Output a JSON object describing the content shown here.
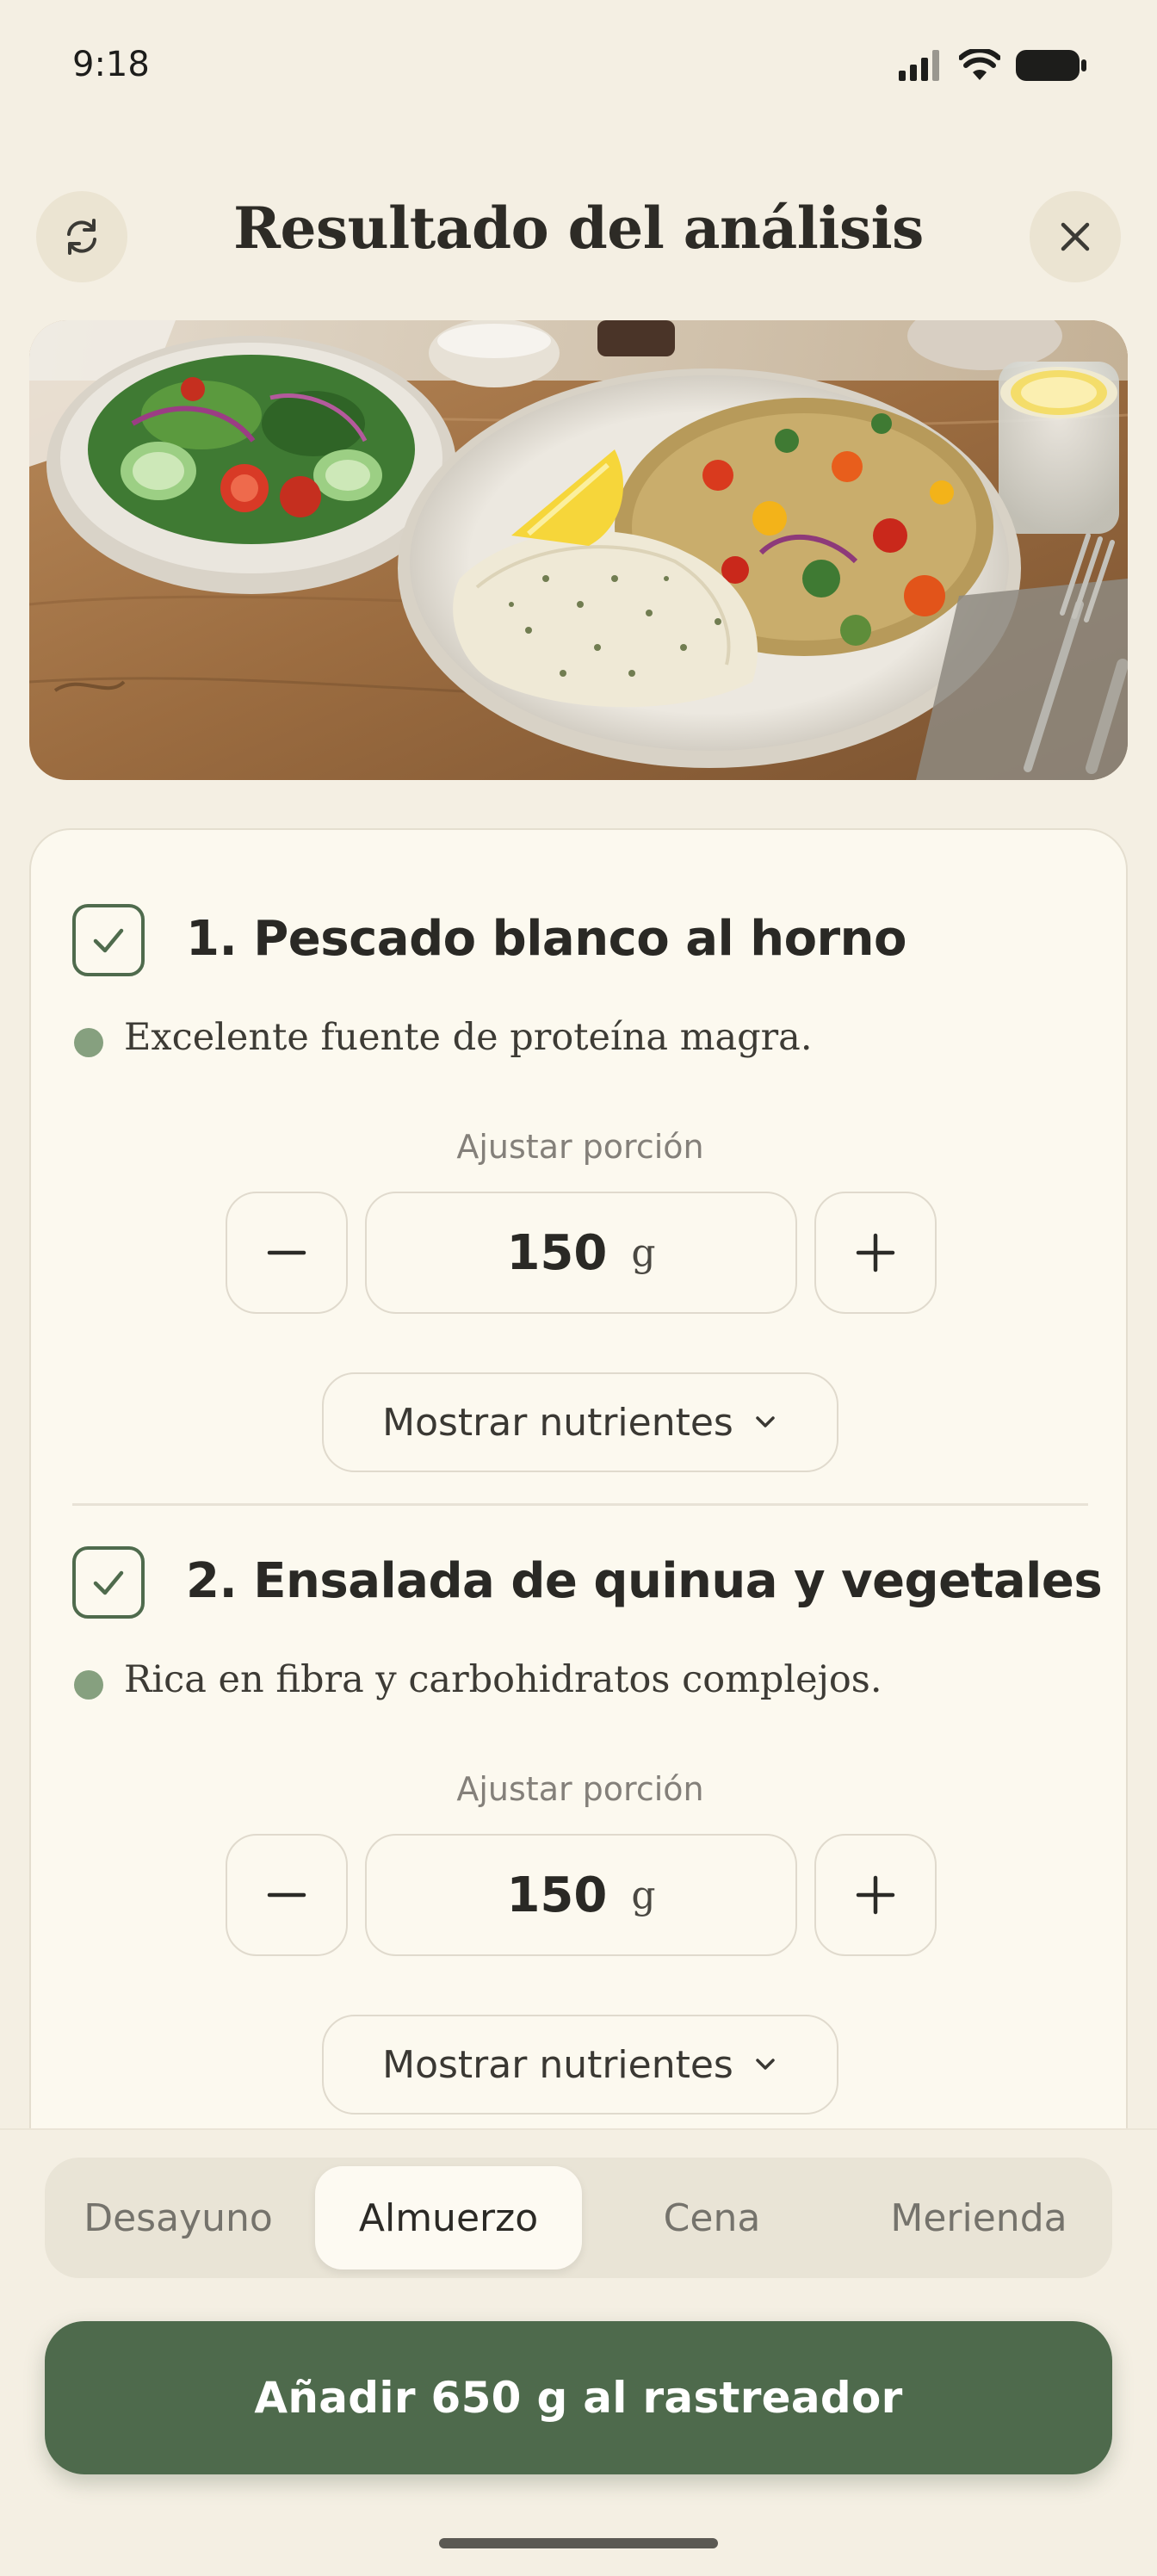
{
  "status_bar": {
    "time": "9:18"
  },
  "header": {
    "title": "Resultado del análisis",
    "refresh_icon": "refresh-icon",
    "close_icon": "close-icon"
  },
  "hero_image": {
    "subject": "baked white fish, quinoa vegetable salad, green salad, lemon water"
  },
  "items": [
    {
      "name": "1. Pescado blanco al horno",
      "description": "Excelente fuente de proteína magra.",
      "checked": true,
      "portion_label": "Ajustar porción",
      "quantity": "150",
      "unit": "g",
      "nutrients_label": "Mostrar nutrientes"
    },
    {
      "name": "2. Ensalada de quinua y vegetales",
      "description": "Rica en fibra y carbohidratos complejos.",
      "checked": true,
      "portion_label": "Ajustar porción",
      "quantity": "150",
      "unit": "g",
      "nutrients_label": "Mostrar nutrientes"
    }
  ],
  "meals": {
    "options": [
      "Desayuno",
      "Almuerzo",
      "Cena",
      "Merienda"
    ],
    "selected": "Almuerzo"
  },
  "add_button": {
    "label": "Añadir 650 g al rastreador"
  },
  "colors": {
    "background": "#f4efe3",
    "accent_green": "#4e6a4c",
    "card": "#fcf9ef",
    "dot": "#86a07f"
  }
}
